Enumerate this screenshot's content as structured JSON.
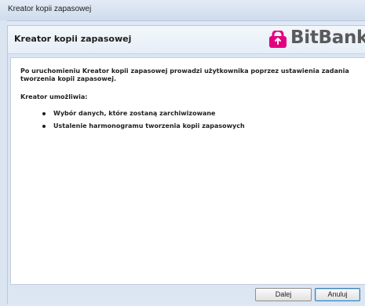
{
  "window": {
    "title": "Kreator kopii zapasowej"
  },
  "header": {
    "title": "Kreator kopii zapasowej",
    "logo_text": "BitBank",
    "logo_icon": "lock-icon",
    "logo_color": "#e3007e"
  },
  "body": {
    "intro": "Po uruchomieniu Kreator kopii zapasowej prowadzi użytkownika poprzez ustawienia zadania tworzenia kopii zapasowej.",
    "subheading": "Kreator umożliwia:",
    "bullets": [
      "Wybór danych, które zostaną zarchiwizowane",
      "Ustalenie harmonogramu tworzenia kopii zapasowych"
    ]
  },
  "buttons": {
    "next": "Dalej",
    "cancel": "Anuluj"
  }
}
